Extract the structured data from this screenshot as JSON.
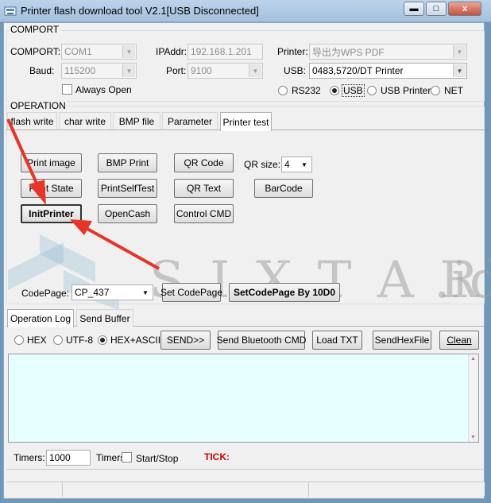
{
  "window": {
    "title": "Printer flash download tool V2.1[USB Disconnected]",
    "controls": {
      "minimize": "▬",
      "maximize": "□",
      "close": "x"
    }
  },
  "comport": {
    "group_label": "COMPORT",
    "comport_label": "COMPORT:",
    "comport_value": "COM1",
    "baud_label": "Baud:",
    "baud_value": "115200",
    "always_open_label": "Always Open",
    "ipaddr_label": "IPAddr:",
    "ipaddr_value": "192.168.1.201",
    "port_label": "Port:",
    "port_value": "9100",
    "printer_label": "Printer:",
    "printer_value": "导出为WPS PDF",
    "usb_label": "USB:",
    "usb_value": "0483,5720/DT Printer",
    "radios": [
      "RS232",
      "USB",
      "USB Printer",
      "NET"
    ],
    "selected_radio": "USB"
  },
  "operation": {
    "group_label": "OPERATION",
    "tabs": [
      "flash write",
      "char write",
      "BMP file",
      "Parameter",
      "Printer test"
    ],
    "active_tab": "Printer test",
    "buttons": {
      "print_image": "Print image",
      "bmp_print": "BMP Print",
      "qr_code": "QR Code",
      "print_state": "Print State",
      "print_self_test": "PrintSelfTest",
      "qr_text": "QR Text",
      "barcode": "BarCode",
      "init_printer": "InitPrinter",
      "open_cash": "OpenCash",
      "control_cmd": "Control CMD"
    },
    "qr_size_label": "QR size:",
    "qr_size_value": "4",
    "codepage_label": "CodePage:",
    "codepage_value": "CP_437",
    "set_codepage": "Set CodePage",
    "set_codepage_by": "SetCodePage By 10D0"
  },
  "log": {
    "tabs": [
      "Operation Log",
      "Send Buffer"
    ],
    "active_tab": "Operation Log",
    "radios": [
      "HEX",
      "UTF-8",
      "HEX+ASCII"
    ],
    "selected_radio": "HEX+ASCII",
    "buttons": {
      "send": "SEND>>",
      "send_bluetooth": "Send Bluetooth CMD",
      "load_txt": "Load TXT",
      "send_hex_file": "SendHexFile",
      "clean": "Clean"
    },
    "timers_label": "Timers:",
    "timers_value": "1000",
    "timers_label2": "Timers",
    "start_stop_label": "Start/Stop",
    "tick_label": "TICK:"
  },
  "watermark": {
    "text": "S I X T A R",
    "suffix": ".id"
  },
  "colors": {
    "log_bg": "#e6ffff",
    "arrow": "#e8352a",
    "tick": "#cc0000",
    "titlebar": "#a9c4e0"
  }
}
